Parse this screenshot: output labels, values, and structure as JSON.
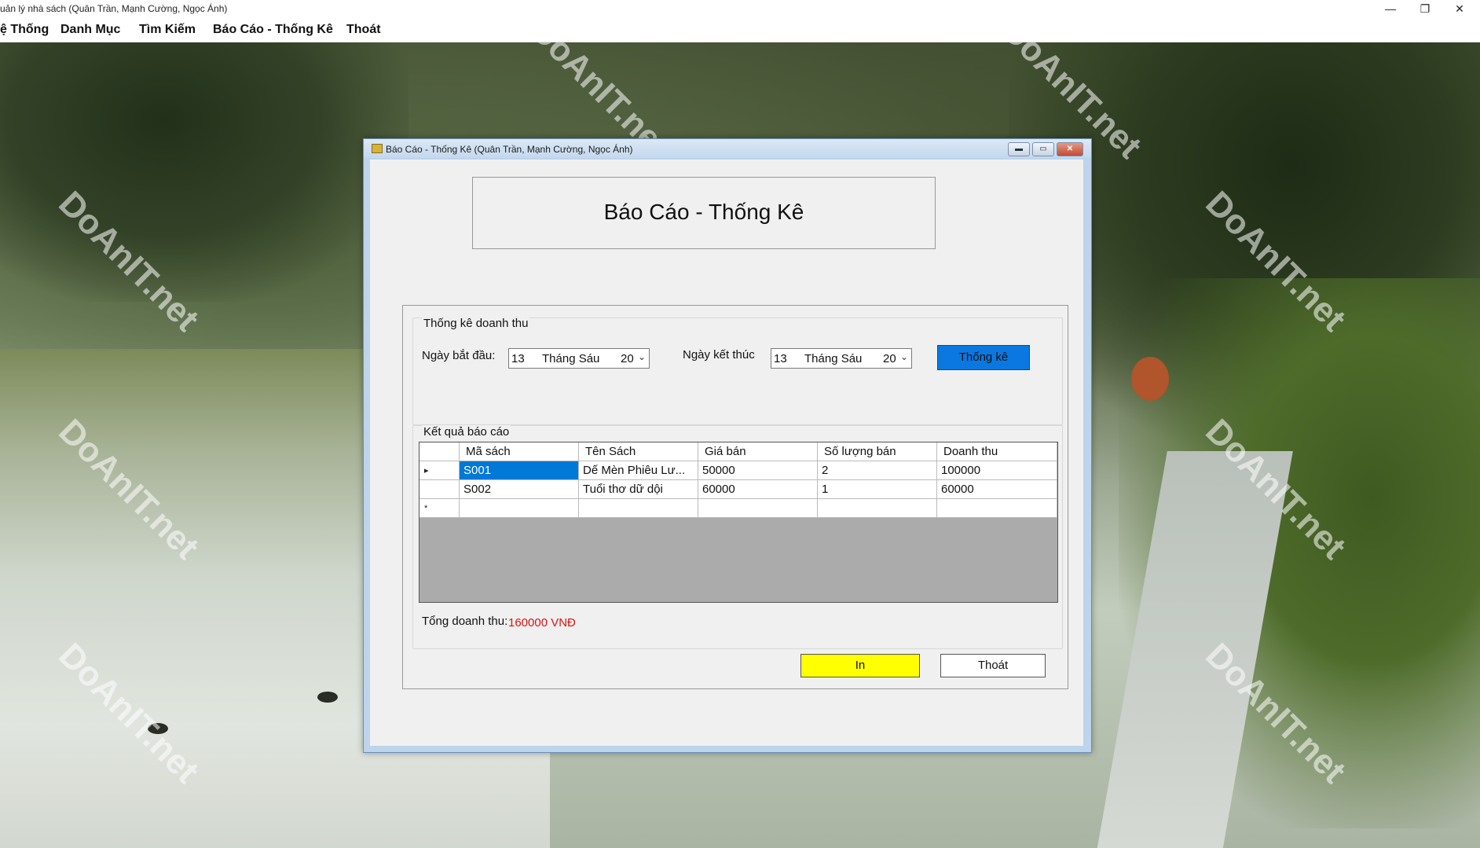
{
  "app": {
    "title": "uản lý nhà sách (Quân Trần, Mạnh Cường, Ngọc Ánh)",
    "menu": [
      "ệ Thống",
      "Danh Mục",
      "Tìm Kiếm",
      "Báo Cáo - Thống Kê",
      "Thoát"
    ],
    "window_controls": {
      "minimize": "—",
      "restore": "❐",
      "close": "✕"
    }
  },
  "watermark": {
    "text": "DoAnIT.net"
  },
  "dialog": {
    "title": "Báo Cáo - Thống Kê (Quân Trần, Mạnh Cường, Ngọc Ánh)",
    "controls": {
      "minimize": "▬",
      "restore": "▭",
      "close": "✕"
    },
    "header": "Báo Cáo - Thống Kê",
    "revenue_group": {
      "label": "Thống kê doanh thu",
      "start_label": "Ngày bắt đầu:",
      "start_date": {
        "day": "13",
        "month": "Tháng Sáu",
        "year": "20"
      },
      "end_label": "Ngày kết thúc",
      "end_date": {
        "day": "13",
        "month": "Tháng Sáu",
        "year": "20"
      },
      "stat_button": "Thống kê"
    },
    "result_group": {
      "label": "Kết quả báo cáo",
      "columns": [
        "Mã sách",
        "Tên Sách",
        "Giá bán",
        "Số lượng bán",
        "Doanh thu"
      ],
      "rows": [
        {
          "ma": "S001",
          "ten": "Dế Mèn Phiêu Lư...",
          "gia": "50000",
          "sl": "2",
          "dt": "100000",
          "marker": "▸"
        },
        {
          "ma": "S002",
          "ten": "Tuổi thơ dữ dội",
          "gia": "60000",
          "sl": "1",
          "dt": "60000",
          "marker": ""
        }
      ],
      "new_row_marker": "*",
      "total_label": "Tổng doanh thu:",
      "total_value": "160000 VNĐ"
    },
    "print_button": "In",
    "exit_button": "Thoát",
    "colors": {
      "stat_button": "#0a78e0",
      "print_button": "#ffff00",
      "total_value": "#e01010",
      "selected_cell": "#0078d7"
    }
  }
}
